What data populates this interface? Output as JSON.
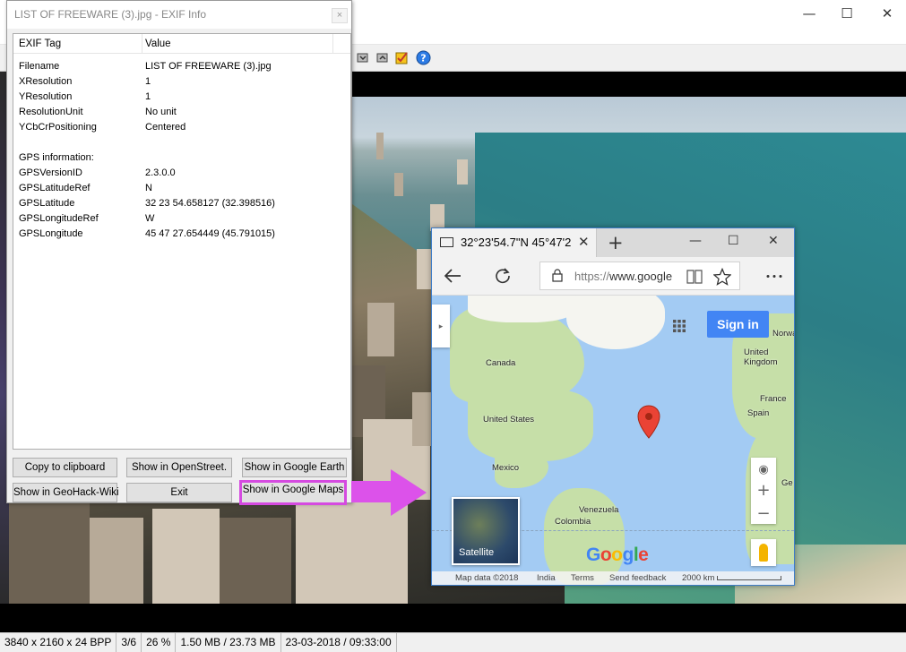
{
  "exif": {
    "title": "LIST OF FREEWARE (3).jpg - EXIF Info",
    "close": "×",
    "col_tag": "EXIF Tag",
    "col_value": "Value",
    "rows": [
      {
        "tag": "Filename",
        "value": "LIST OF FREEWARE (3).jpg"
      },
      {
        "tag": "XResolution",
        "value": "1"
      },
      {
        "tag": "YResolution",
        "value": "1"
      },
      {
        "tag": "ResolutionUnit",
        "value": "No unit"
      },
      {
        "tag": "YCbCrPositioning",
        "value": "Centered"
      },
      {
        "tag": "GPS information:",
        "value": ""
      },
      {
        "tag": "GPSVersionID",
        "value": "2.3.0.0"
      },
      {
        "tag": "GPSLatitudeRef",
        "value": "N"
      },
      {
        "tag": "GPSLatitude",
        "value": "32  23  54.658127 (32.398516)"
      },
      {
        "tag": "GPSLongitudeRef",
        "value": "W"
      },
      {
        "tag": "GPSLongitude",
        "value": "45  47  27.654449 (45.791015)"
      }
    ],
    "buttons": {
      "copy": "Copy to clipboard",
      "openstreet": "Show in OpenStreet.",
      "google_earth": "Show in Google Earth",
      "geohack": "Show in GeoHack-Wiki",
      "exit": "Exit",
      "google_maps": "Show in Google Maps"
    }
  },
  "viewer": {
    "controls": {
      "minimize": "—",
      "maximize": "☐",
      "close": "✕"
    },
    "status": [
      "3840 x 2160 x 24 BPP",
      "3/6",
      "26 %",
      "1.50 MB / 23.73 MB",
      "23-03-2018 / 09:33:00"
    ]
  },
  "browser": {
    "tab_title": "32°23'54.7\"N 45°47'2",
    "tab_close": "✕",
    "new_tab": "+",
    "controls": {
      "minimize": "—",
      "maximize": "☐",
      "close": "✕"
    },
    "url_dim": "https://",
    "url_main": "www.google",
    "map": {
      "sign_in": "Sign in",
      "labels": {
        "canada": "Canada",
        "united_states": "United States",
        "mexico": "Mexico",
        "venezuela": "Venezuela",
        "colombia": "Colombia",
        "united_kingdom": "United\nKingdom",
        "france": "France",
        "spain": "Spain",
        "norway": "Norwa",
        "ge": "Ge",
        "satellite": "Satellite"
      },
      "footer": {
        "map_data": "Map data ©2018",
        "india": "India",
        "terms": "Terms",
        "feedback": "Send feedback",
        "scale": "2000 km"
      },
      "logo": [
        "G",
        "o",
        "o",
        "g",
        "l",
        "e"
      ],
      "logo_colors": [
        "#4285f4",
        "#ea4335",
        "#fbbc05",
        "#4285f4",
        "#34a853",
        "#ea4335"
      ]
    }
  }
}
